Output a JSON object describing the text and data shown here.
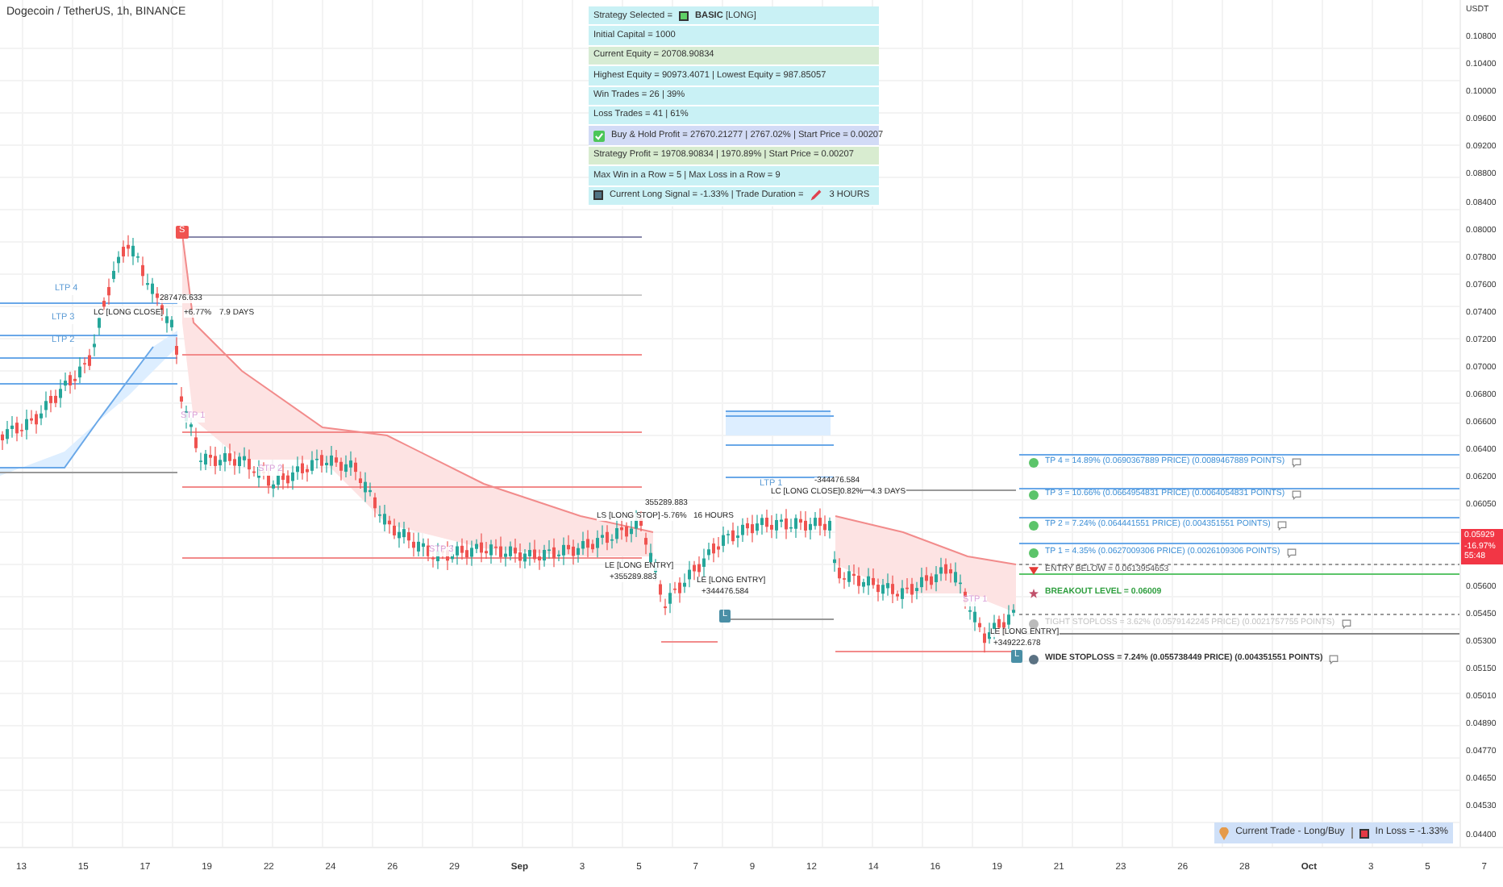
{
  "header": {
    "title": "Dogecoin / TetherUS, 1h, BINANCE"
  },
  "info_panel": {
    "rows": [
      {
        "color": "#c9f1f5",
        "segments": [
          {
            "kind": "text",
            "text": "Strategy Selected ="
          },
          {
            "kind": "square",
            "color": "#5fd068"
          },
          {
            "kind": "text",
            "text": "**BASIC** [LONG]"
          }
        ]
      },
      {
        "color": "#c9f1f5",
        "segments": [
          {
            "kind": "text",
            "text": "Initial Capital = 1000"
          }
        ]
      },
      {
        "color": "#d7ecd4",
        "segments": [
          {
            "kind": "text",
            "text": "Current Equity = 20708.90834"
          }
        ]
      },
      {
        "color": "#c9f1f5",
        "segments": [
          {
            "kind": "text",
            "text": "Highest Equity = 90973.4071  |  Lowest Equity = 987.85057"
          }
        ]
      },
      {
        "color": "#c9f1f5",
        "segments": [
          {
            "kind": "text",
            "text": "Win Trades = 26  |  39%"
          }
        ]
      },
      {
        "color": "#c9f1f5",
        "segments": [
          {
            "kind": "text",
            "text": "Loss Trades = 41  |  61%"
          }
        ]
      },
      {
        "color": "#d2dbf6",
        "segments": [
          {
            "kind": "checkbox",
            "color": "#4cc659"
          },
          {
            "kind": "text",
            "text": "Buy & Hold Profit = 27670.21277  |  2767.02%  |  Start Price = 0.00207"
          }
        ]
      },
      {
        "color": "#d8ecd0",
        "segments": [
          {
            "kind": "text",
            "text": "Strategy Profit = 19708.90834  |  1970.89%  |  Start Price = 0.00207"
          }
        ]
      },
      {
        "color": "#c9f1f5",
        "segments": [
          {
            "kind": "text",
            "text": "Max Win in a Row = 5  |  Max Loss in a Row = 9"
          }
        ]
      },
      {
        "color": "#c9f1f5",
        "segments": [
          {
            "kind": "square",
            "color": "#4f7384"
          },
          {
            "kind": "text",
            "text": "Current Long Signal = -1.33%  |  Trade Duration ="
          },
          {
            "kind": "pencil"
          },
          {
            "kind": "text",
            "text": "3 HOURS"
          }
        ]
      }
    ]
  },
  "levels": [
    {
      "kind": "tp",
      "text": "TP 4 = 14.89% (0.0690367889 PRICE) (0.0089467889 POINTS)"
    },
    {
      "kind": "tp",
      "text": "TP 3 = 10.66% (0.0664954831 PRICE) (0.0064054831 POINTS)"
    },
    {
      "kind": "tp",
      "text": "TP 2 = 7.24% (0.064441551 PRICE) (0.004351551 POINTS)"
    },
    {
      "kind": "tp",
      "text": "TP 1 = 4.35% (0.0627009306 PRICE) (0.0026109306 POINTS)"
    },
    {
      "kind": "entry",
      "text": "ENTRY BELOW = 0.0613954653"
    },
    {
      "kind": "breakout",
      "text": "BREAKOUT LEVEL = 0.06009"
    },
    {
      "kind": "tight_stop",
      "text": "TIGHT STOPLOSS = 3.62% (0.0579142245 PRICE) (0.0021757755 POINTS)"
    },
    {
      "kind": "wide_stop",
      "text": "WIDE STOPLOSS = 7.24% (0.055738449 PRICE) (0.004351551 POINTS)"
    }
  ],
  "annotations": [
    {
      "kind": "tp",
      "text": "LTP 4"
    },
    {
      "kind": "tp",
      "text": "LTP 3"
    },
    {
      "kind": "tp",
      "text": "LTP 2"
    },
    {
      "kind": "trade",
      "text": "287476.633"
    },
    {
      "kind": "trade",
      "text": "LC [LONG CLOSE]"
    },
    {
      "kind": "trade",
      "text": "+6.77%"
    },
    {
      "kind": "trade",
      "text": "7.9 DAYS"
    },
    {
      "kind": "stp",
      "text": "STP 1"
    },
    {
      "kind": "stp",
      "text": "STP 2"
    },
    {
      "kind": "stp",
      "text": "STP 3"
    },
    {
      "kind": "trade",
      "text": "355289.883"
    },
    {
      "kind": "trade",
      "text": "LS [LONG STOP]"
    },
    {
      "kind": "trade",
      "text": "-5.76%"
    },
    {
      "kind": "trade",
      "text": "16 HOURS"
    },
    {
      "kind": "trade",
      "text": "LE [LONG ENTRY]"
    },
    {
      "kind": "trade",
      "text": "+355289.883"
    },
    {
      "kind": "trade",
      "text": "LE [LONG ENTRY]"
    },
    {
      "kind": "trade",
      "text": "+344476.584"
    },
    {
      "kind": "tp",
      "text": "LTP 1"
    },
    {
      "kind": "trade",
      "text": "-344476.584"
    },
    {
      "kind": "trade",
      "text": "LC [LONG CLOSE]"
    },
    {
      "kind": "trade",
      "text": "0.82%"
    },
    {
      "kind": "trade",
      "text": "4.3 DAYS"
    },
    {
      "kind": "stp",
      "text": "STP 1"
    },
    {
      "kind": "trade",
      "text": "LE [LONG ENTRY]"
    },
    {
      "kind": "trade",
      "text": "+349222.678"
    },
    {
      "kind": "short_marker",
      "text": "S"
    },
    {
      "kind": "long_marker",
      "text": "L"
    },
    {
      "kind": "long_marker",
      "text": "L"
    }
  ],
  "price_axis": {
    "unit": "USDT",
    "ticks": [
      "0.10800",
      "0.10400",
      "0.10000",
      "0.09600",
      "0.09200",
      "0.08800",
      "0.08400",
      "0.08000",
      "0.07800",
      "0.07600",
      "0.07400",
      "0.07200",
      "0.07000",
      "0.06800",
      "0.06600",
      "0.06400",
      "0.06200",
      "0.06050",
      "0.05600",
      "0.05450",
      "0.05300",
      "0.05150",
      "0.05010",
      "0.04890",
      "0.04770",
      "0.04650",
      "0.04530",
      "0.04400"
    ],
    "last_price": {
      "price": "0.05929",
      "change": "-16.97%",
      "countdown": "55:48"
    }
  },
  "time_axis": {
    "ticks": [
      "13",
      "15",
      "17",
      "19",
      "22",
      "24",
      "26",
      "29",
      "Sep",
      "3",
      "5",
      "7",
      "9",
      "12",
      "14",
      "16",
      "19",
      "21",
      "23",
      "26",
      "28",
      "Oct",
      "3",
      "5",
      "7"
    ]
  },
  "status": {
    "trade": "Current Trade - Long/Buy",
    "result": "In Loss = -1.33%"
  }
}
